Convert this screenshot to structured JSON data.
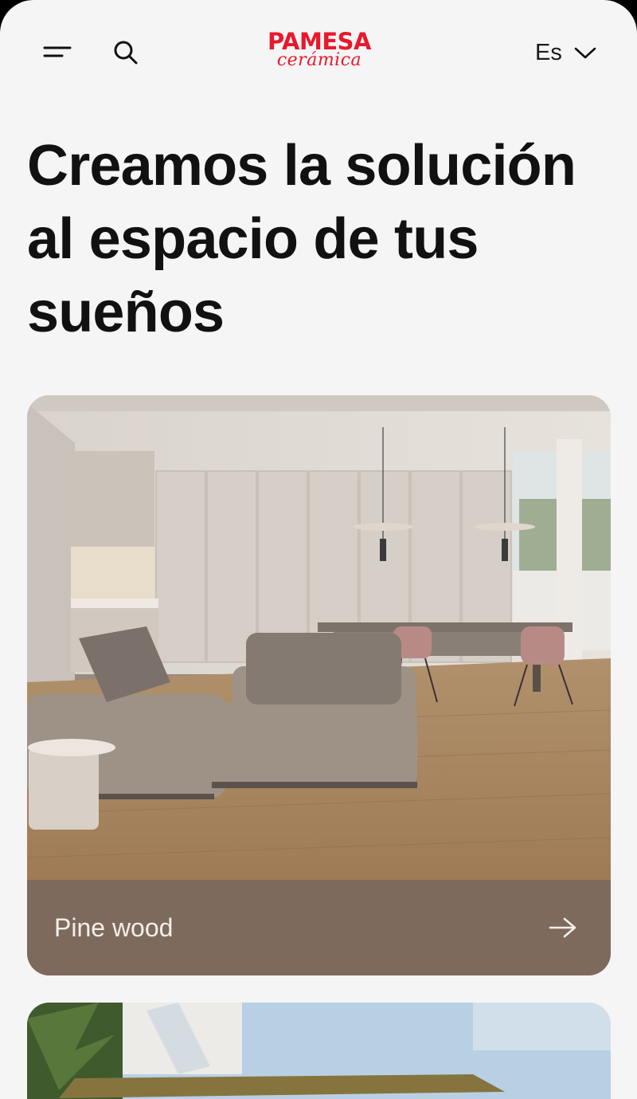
{
  "header": {
    "menu_icon": "menu-icon",
    "search_icon": "search-icon",
    "logo": {
      "brand": "PAMESA",
      "sub": "cerámica",
      "color": "#e8192c"
    },
    "language": {
      "selected": "Es",
      "icon": "chevron-down-icon"
    }
  },
  "hero": {
    "headline": "Creamos la solución al espacio de tus sueños"
  },
  "cards": [
    {
      "label": "Pine wood",
      "icon": "arrow-right-icon",
      "footer_color": "#7e6a5d"
    },
    {
      "label": ""
    }
  ],
  "colors": {
    "background": "#f5f5f5",
    "text": "#111111",
    "brand": "#e8192c"
  }
}
